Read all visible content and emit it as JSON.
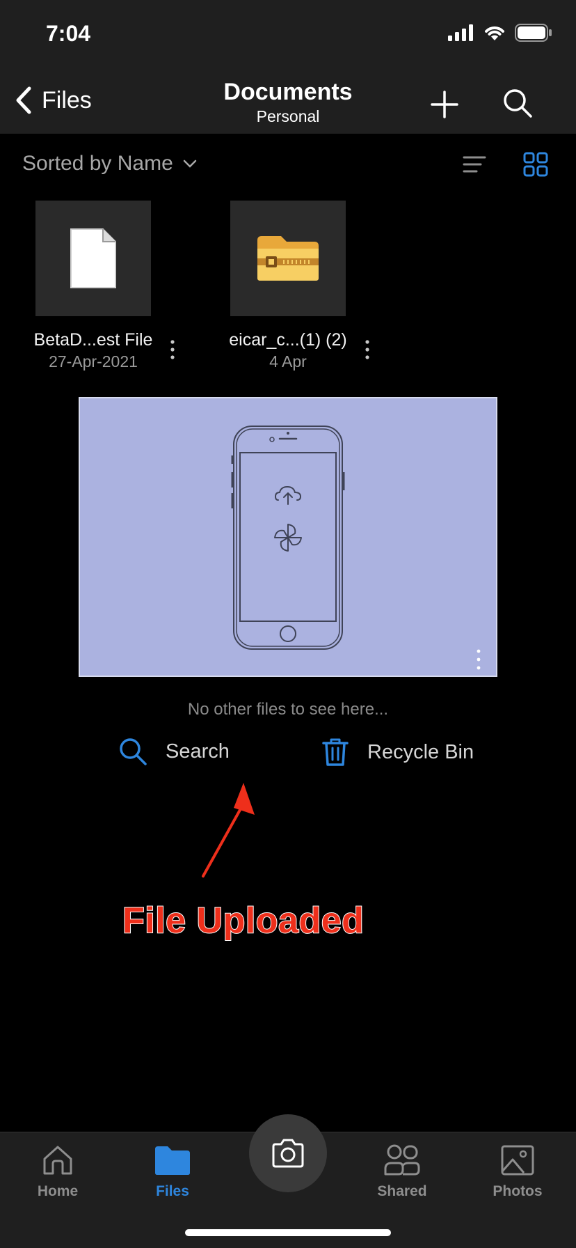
{
  "status_bar": {
    "time": "7:04"
  },
  "header": {
    "back_label": "Files",
    "title": "Documents",
    "subtitle": "Personal"
  },
  "sort": {
    "label": "Sorted by Name"
  },
  "files": [
    {
      "name": "BetaD...est File",
      "date": "27-Apr-2021",
      "icon": "document-icon"
    },
    {
      "name": "eicar_c...(1) (2)",
      "date": "4 Apr",
      "icon": "zip-folder-icon"
    }
  ],
  "empty_message": "No other files to see here...",
  "actions": {
    "search_label": "Search",
    "recycle_label": "Recycle Bin"
  },
  "annotation": {
    "text": "File Uploaded",
    "color": "#ee2f1b"
  },
  "tabs": [
    {
      "label": "Home",
      "icon": "home-icon",
      "active": false
    },
    {
      "label": "Files",
      "icon": "folder-icon",
      "active": true
    },
    {
      "label": "Shared",
      "icon": "people-icon",
      "active": false
    },
    {
      "label": "Photos",
      "icon": "photo-icon",
      "active": false
    }
  ],
  "colors": {
    "accent": "#2e86de",
    "promo_bg": "#abb2e0"
  }
}
